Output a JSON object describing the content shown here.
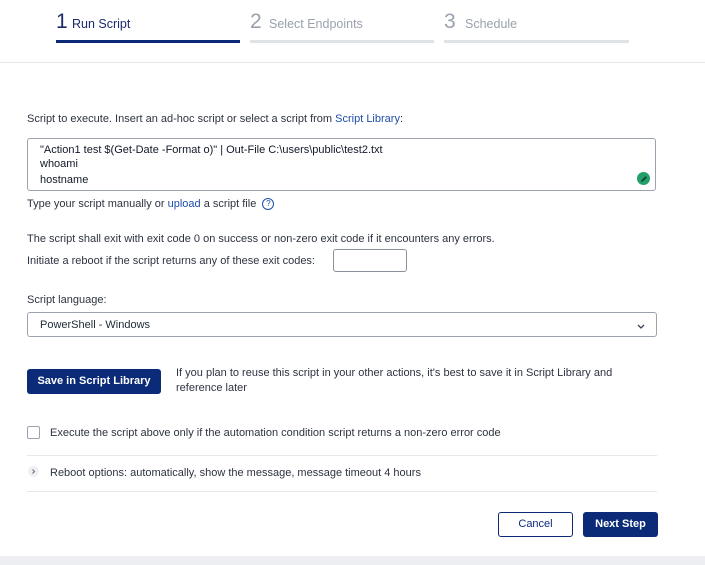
{
  "stepper": {
    "steps": [
      {
        "number": "1",
        "label": "Run Script",
        "state": "active"
      },
      {
        "number": "2",
        "label": "Select Endpoints",
        "state": "inactive"
      },
      {
        "number": "3",
        "label": "Schedule",
        "state": "inactive"
      }
    ]
  },
  "script": {
    "intro_prefix": "Script to execute. Insert an ad-hoc script or select a script from",
    "intro_link": "Script Library",
    "intro_suffix": ":",
    "lines": [
      "\"Action1 test $(Get-Date -Format o)\" | Out-File C:\\users\\public\\test2.txt",
      "whoami",
      "hostname"
    ],
    "edit_icon": "pencil-icon",
    "hint_prefix": "Type your script manually or",
    "hint_link": "upload",
    "hint_suffix": "a script file",
    "help_glyph": "?"
  },
  "exit": {
    "note": "The script shall exit with exit code 0 on success or non-zero exit code if it encounters any errors.",
    "reboot_label": "Initiate a reboot if the script returns any of these exit codes:",
    "reboot_value": ""
  },
  "language": {
    "label": "Script language:",
    "value": "PowerShell - Windows"
  },
  "library": {
    "button": "Save in Script Library",
    "note_line1": "If you plan to reuse this script in your other actions, it's best to save it in Script Library and",
    "note_line2": "reference later"
  },
  "condition": {
    "checked": false,
    "label": "Execute the script above only if the automation condition script returns a non-zero error code"
  },
  "reboot": {
    "label": "Reboot options: automatically, show the message, message timeout 4 hours"
  },
  "footer": {
    "cancel": "Cancel",
    "next": "Next Step"
  },
  "colors": {
    "primary": "#0b2a78",
    "link": "#1d4ea8",
    "edit_green": "#22a06b"
  }
}
